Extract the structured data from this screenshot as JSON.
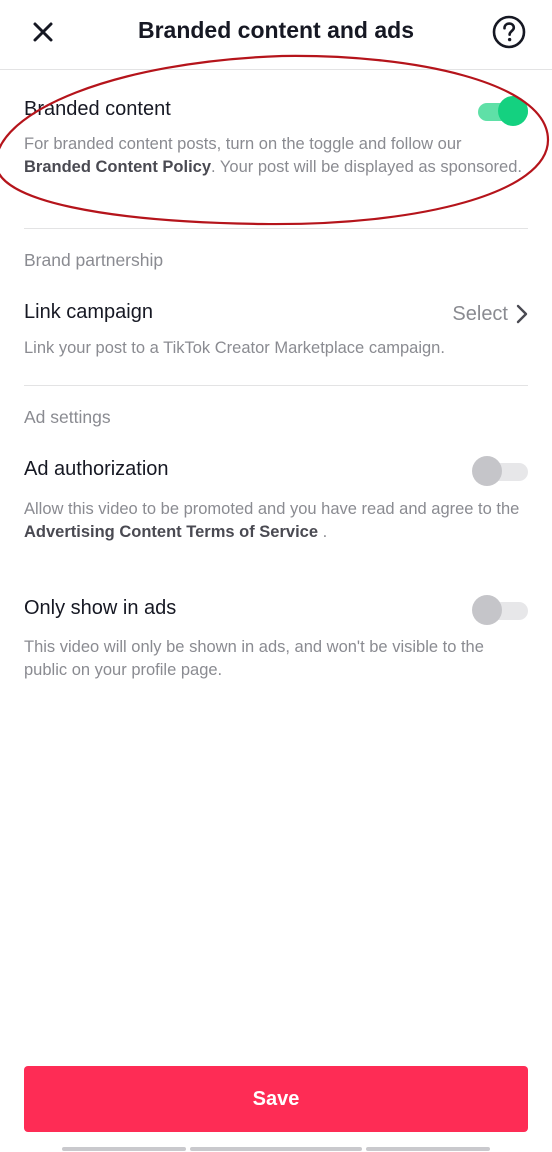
{
  "header": {
    "title": "Branded content and ads",
    "close_icon": "close-icon",
    "help_icon": "help-circle-icon"
  },
  "branded_content": {
    "label": "Branded content",
    "toggle_on": true,
    "desc_pre": "For branded content posts, turn on the toggle and follow our ",
    "desc_link": "Branded Content Policy",
    "desc_post": ". Your post will be displayed as sponsored."
  },
  "brand_partnership": {
    "group_title": "Brand partnership",
    "link_campaign_label": "Link campaign",
    "select_label": "Select",
    "desc": "Link your post to a TikTok Creator Marketplace campaign."
  },
  "ad_settings": {
    "group_title": "Ad settings",
    "ad_authorization": {
      "label": "Ad authorization",
      "toggle_on": false,
      "desc_pre": "Allow this video to be promoted and you have read and agree to the ",
      "desc_link": "Advertising Content Terms of Service",
      "desc_post": " ."
    },
    "only_show_in_ads": {
      "label": "Only show in ads",
      "toggle_on": false,
      "desc": "This video will only be shown in ads, and won't be visible to the public on your profile page."
    }
  },
  "footer": {
    "save_label": "Save"
  },
  "colors": {
    "accent": "#fe2c55",
    "toggle_on": "#14d180",
    "annotation": "#b5141b"
  }
}
